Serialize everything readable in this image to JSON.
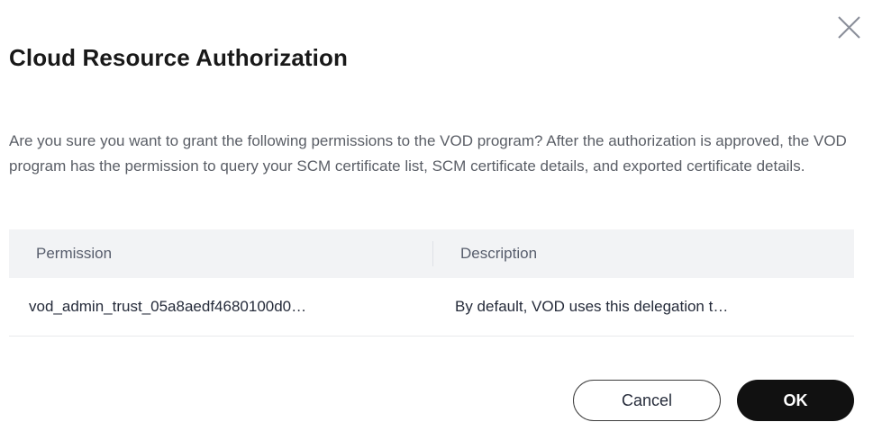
{
  "dialog": {
    "title": "Cloud Resource Authorization",
    "message": "Are you sure you want to grant the following permissions to the VOD program? After the authorization is approved, the VOD program has the permission to query your SCM certificate list, SCM certificate details, and exported certificate details.",
    "close_icon": "close-icon"
  },
  "table": {
    "headers": {
      "permission": "Permission",
      "description": "Description"
    },
    "rows": [
      {
        "permission": "vod_admin_trust_05a8aedf4680100d0…",
        "description": "By default, VOD uses this delegation t…"
      }
    ]
  },
  "buttons": {
    "cancel_label": "Cancel",
    "ok_label": "OK"
  },
  "colors": {
    "primary_button": "#111111",
    "header_background": "#f2f3f5"
  }
}
